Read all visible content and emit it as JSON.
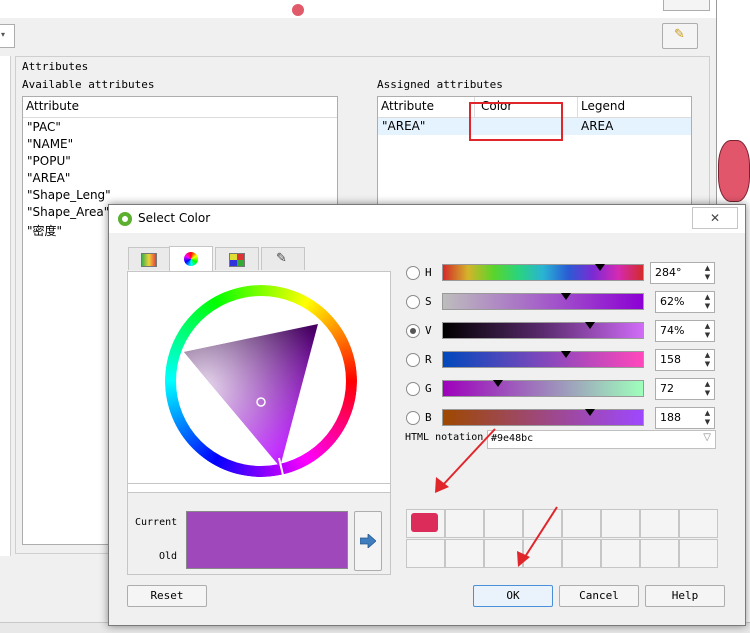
{
  "background_window": {
    "attributes_title": "Attributes",
    "available_label": "Available attributes",
    "assigned_label": "Assigned attributes",
    "available_header": "Attribute",
    "available_items": [
      "\"PAC\"",
      "\"NAME\"",
      "\"POPU\"",
      "\"AREA\"",
      "\"Shape_Leng\"",
      "\"Shape_Area\"",
      "\"密度\""
    ],
    "assigned_headers": [
      "Attribute",
      "Color",
      "Legend"
    ],
    "assigned_row": [
      "\"AREA\"",
      "",
      "AREA"
    ]
  },
  "dialog": {
    "title": "Select Color",
    "close_label": "✕",
    "tabs": [
      "color-ramp",
      "color-wheel",
      "color-swatches",
      "color-picker"
    ],
    "channels": [
      {
        "letter": "H",
        "value": "284°",
        "thumb_frac": 0.79,
        "selected": false,
        "gradient": "linear-gradient(90deg,#d42a2a,#d4b42a,#5cd42a,#2ad47c,#2ab4d4,#2a5cd4,#7c2ad4,#d42ab4,#d42a2a)"
      },
      {
        "letter": "S",
        "value": "62%",
        "thumb_frac": 0.62,
        "selected": false,
        "gradient": "linear-gradient(90deg,#bdbdbd,#8c00d4)"
      },
      {
        "letter": "V",
        "value": "74%",
        "thumb_frac": 0.74,
        "selected": true,
        "gradient": "linear-gradient(90deg,#000000,#5a2a6e,#d06cf8)"
      },
      {
        "letter": "R",
        "value": "158",
        "thumb_frac": 0.62,
        "selected": false,
        "gradient": "linear-gradient(90deg,#0048bc,#ff48bc)"
      },
      {
        "letter": "G",
        "value": "72",
        "thumb_frac": 0.28,
        "selected": false,
        "gradient": "linear-gradient(90deg,#9e00bc,#9effbc)"
      },
      {
        "letter": "B",
        "value": "188",
        "thumb_frac": 0.74,
        "selected": false,
        "gradient": "linear-gradient(90deg,#9e4800,#9e48ff)"
      }
    ],
    "html_notation_label": "HTML notation",
    "html_notation_value": "#9e48bc",
    "current_label": "Current",
    "old_label": "Old",
    "current_color": "#9e48bc",
    "old_color": "#9e48bc",
    "first_swatch_color": "#dc2d5a",
    "buttons": {
      "reset": "Reset",
      "ok": "OK",
      "cancel": "Cancel",
      "help": "Help"
    }
  }
}
